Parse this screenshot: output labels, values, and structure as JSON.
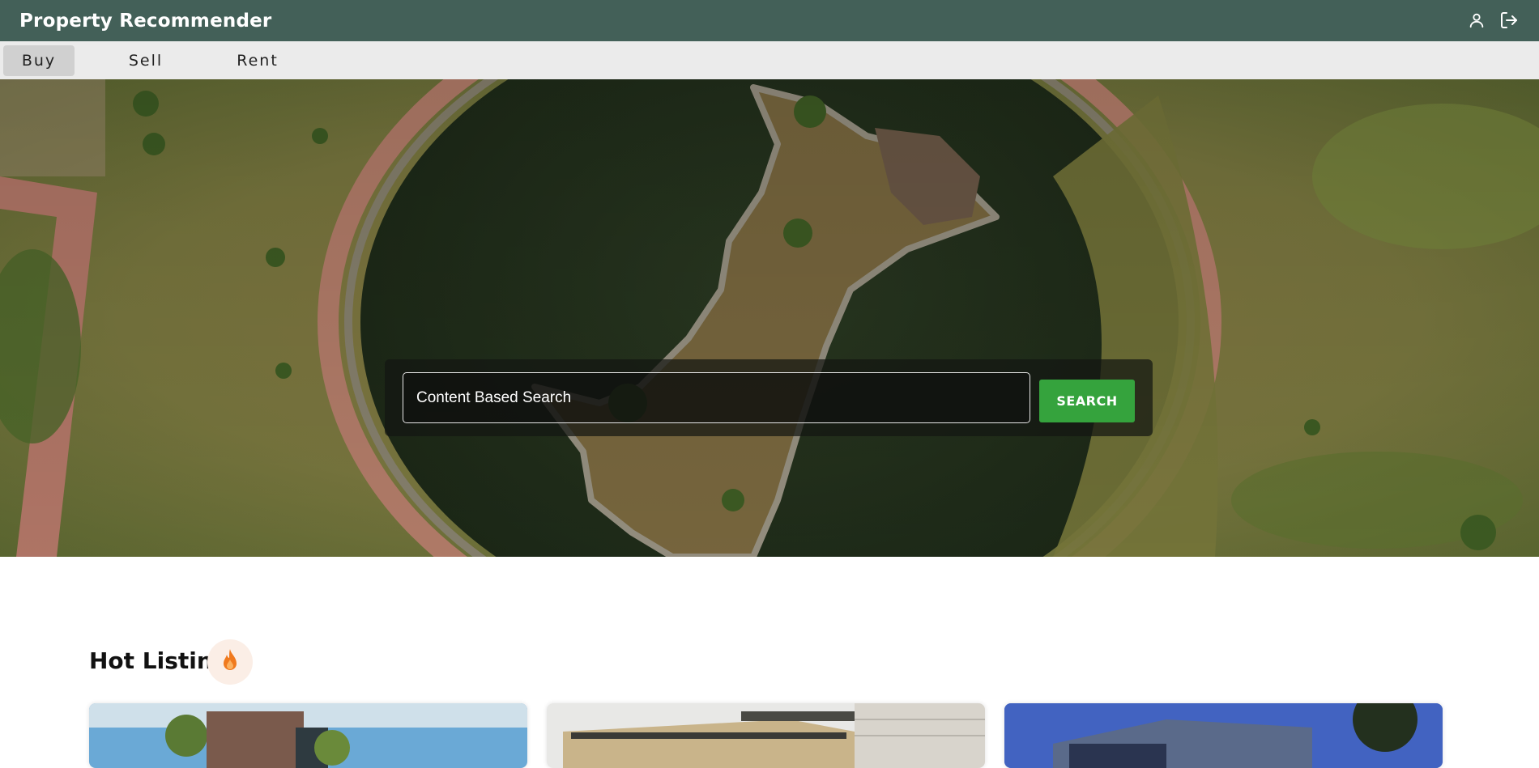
{
  "app": {
    "title": "Property Recommender"
  },
  "header": {
    "icons": [
      {
        "name": "user-icon"
      },
      {
        "name": "logout-icon"
      }
    ]
  },
  "tabs": [
    {
      "label": "Buy",
      "active": true
    },
    {
      "label": "Sell",
      "active": false
    },
    {
      "label": "Rent",
      "active": false
    }
  ],
  "search": {
    "placeholder": "Content Based Search",
    "value": "",
    "button_label": "SEARCH"
  },
  "hot_listing": {
    "title": "Hot Listing",
    "icon": "fire-icon",
    "cards": [
      {
        "image": "modern-house-photo"
      },
      {
        "image": "modern-house-photo"
      },
      {
        "image": "modern-house-photo"
      }
    ]
  },
  "colors": {
    "topbar": "#436058",
    "tabbar": "#ebebeb",
    "active_tab": "#d0d0d0",
    "search_button": "#35a33d",
    "fire_badge": "#fbeee6",
    "fire": "#f07a1e"
  }
}
